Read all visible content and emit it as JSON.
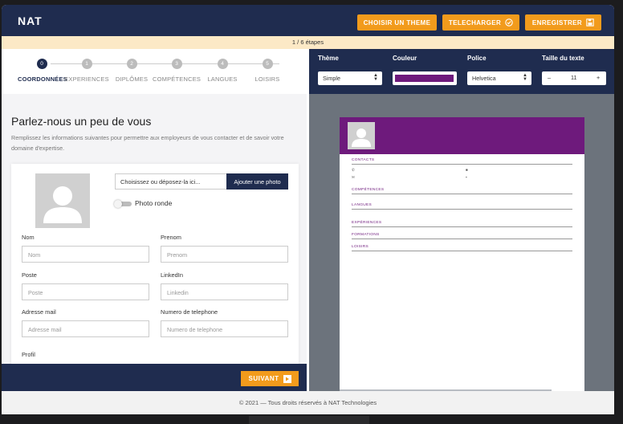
{
  "header": {
    "logo": "NAT",
    "buttons": {
      "theme": "CHOISIR UN THEME",
      "download": "TELECHARGER",
      "save": "ENREGISTRER"
    }
  },
  "progress_text": "1 / 6 étapes",
  "steps": [
    {
      "num": "0",
      "label": "COORDONNÉES",
      "active": true
    },
    {
      "num": "1",
      "label": "EXPERIENCES"
    },
    {
      "num": "2",
      "label": "DIPLÔMES"
    },
    {
      "num": "3",
      "label": "COMPÉTENCES"
    },
    {
      "num": "4",
      "label": "LANGUES"
    },
    {
      "num": "5",
      "label": "LOISIRS"
    }
  ],
  "form": {
    "title": "Parlez-nous un peu de vous",
    "description": "Remplissez les informations suivantes pour permettre aux employeurs de vous contacter et de savoir votre domaine d'expertise.",
    "file_placeholder": "Choisissez ou déposez-la ici...",
    "upload_button": "Ajouter une photo",
    "round_photo_label": "Photo ronde",
    "fields": {
      "nom": {
        "label": "Nom",
        "placeholder": "Nom"
      },
      "prenom": {
        "label": "Prenom",
        "placeholder": "Prenom"
      },
      "poste": {
        "label": "Poste",
        "placeholder": "Poste"
      },
      "linkedin": {
        "label": "LinkedIn",
        "placeholder": "Linkedin"
      },
      "email": {
        "label": "Adresse mail",
        "placeholder": "Adresse mail"
      },
      "phone": {
        "label": "Numero de telephone",
        "placeholder": "Numero de telephone"
      },
      "profil": {
        "label": "Profil"
      }
    },
    "next_button": "SUIVANT"
  },
  "toolbar": {
    "theme": {
      "label": "Thème",
      "value": "Simple"
    },
    "color": {
      "label": "Couleur",
      "value": "#6e1a7c"
    },
    "font": {
      "label": "Police",
      "value": "Helvetica"
    },
    "size": {
      "label": "Taille du texte",
      "value": "11",
      "minus": "–",
      "plus": "+"
    }
  },
  "preview": {
    "sections": [
      "CONTACTS",
      "COMPÉTENCES",
      "LANGUES",
      "EXPÉRIENCES",
      "FORMATIONS",
      "LOISIRS"
    ],
    "header_color": "#6e1a7c"
  },
  "footer": "© 2021 — Tous droits réservés à NAT Technologies"
}
